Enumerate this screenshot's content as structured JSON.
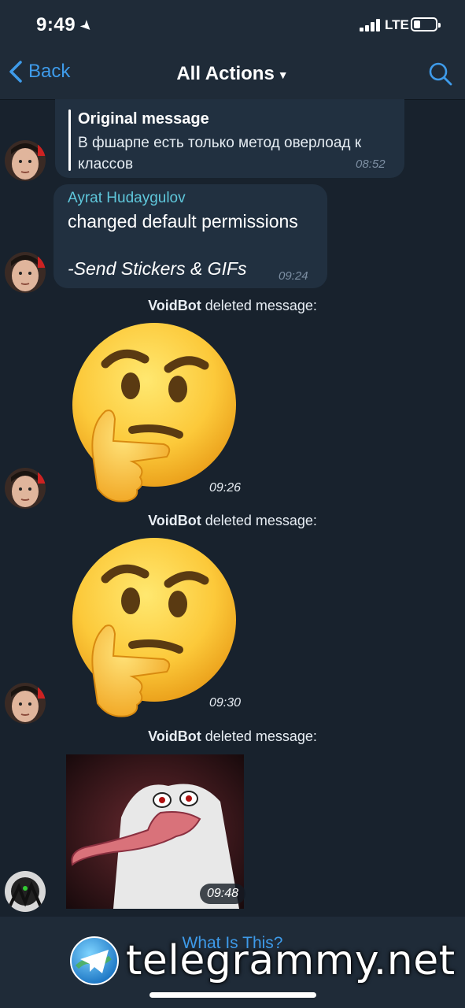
{
  "status_bar": {
    "time": "9:49",
    "network": "LTE"
  },
  "nav": {
    "back_label": "Back",
    "title": "All Actions"
  },
  "messages": {
    "reply": {
      "title": "Original message",
      "text": "В фшарпе есть только метод оверлоад к классов",
      "time": "08:52"
    },
    "permission": {
      "sender": "Ayrat Hudaygulov",
      "text": "changed default permissions",
      "detail": "-Send Stickers & GIFs",
      "time": "09:24"
    },
    "deleted": [
      {
        "actor": "VoidBot",
        "action": " deleted message:",
        "time": "09:26"
      },
      {
        "actor": "VoidBot",
        "action": " deleted message:",
        "time": "09:30"
      },
      {
        "actor": "VoidBot",
        "action": " deleted message:",
        "time": "09:48"
      }
    ]
  },
  "footer": {
    "link": "What Is This?"
  },
  "watermark": {
    "text": "telegrammy.net"
  },
  "colors": {
    "background": "#18222d",
    "bar": "#1f2b38",
    "accent": "#3e9bea",
    "sender": "#5fc7db",
    "bubble": "#213040"
  },
  "icons": [
    "location-arrow-icon",
    "signal-icon",
    "battery-icon",
    "back-chevron-icon",
    "search-icon",
    "caret-down-icon",
    "thinking-face-icon",
    "telegram-logo-icon"
  ]
}
